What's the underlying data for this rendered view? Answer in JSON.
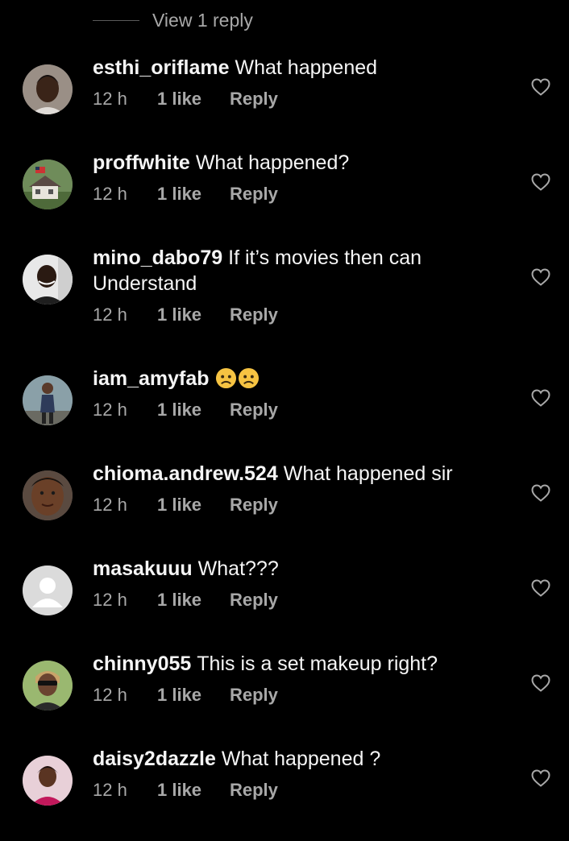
{
  "thread": {
    "view_replies_label": "View 1 reply"
  },
  "comments": [
    {
      "username": "esthi_oriflame",
      "text": "What happened",
      "time": "12 h",
      "likes": "1 like",
      "reply_label": "Reply",
      "avatar": "avatar-woman-portrait"
    },
    {
      "username": "proffwhite",
      "text": "What happened?",
      "time": "12 h",
      "likes": "1 like",
      "reply_label": "Reply",
      "avatar": "avatar-house-flag"
    },
    {
      "username": "mino_dabo79",
      "text": "If it’s movies then can Understand",
      "time": "12 h",
      "likes": "1 like",
      "reply_label": "Reply",
      "avatar": "avatar-man-smiling"
    },
    {
      "username": "iam_amyfab",
      "text": "",
      "emojis": [
        "worried-face-emoji",
        "worried-face-emoji"
      ],
      "time": "12 h",
      "likes": "1 like",
      "reply_label": "Reply",
      "avatar": "avatar-woman-standing"
    },
    {
      "username": "chioma.andrew.524",
      "text": "What happened sir",
      "time": "12 h",
      "likes": "1 like",
      "reply_label": "Reply",
      "avatar": "avatar-woman-face"
    },
    {
      "username": "masakuuu",
      "text": "What???",
      "time": "12 h",
      "likes": "1 like",
      "reply_label": "Reply",
      "avatar": "avatar-default-silhouette"
    },
    {
      "username": "chinny055",
      "text": "This is a set makeup right?",
      "time": "12 h",
      "likes": "1 like",
      "reply_label": "Reply",
      "avatar": "avatar-woman-sunglasses"
    },
    {
      "username": "daisy2dazzle",
      "text": "What happened ?",
      "time": "12 h",
      "likes": "1 like",
      "reply_label": "Reply",
      "avatar": "avatar-woman-pink"
    }
  ],
  "colors": {
    "background": "#000000",
    "text": "#f5f5f5",
    "meta": "#a8a8a8",
    "emoji": "#f6c342"
  }
}
